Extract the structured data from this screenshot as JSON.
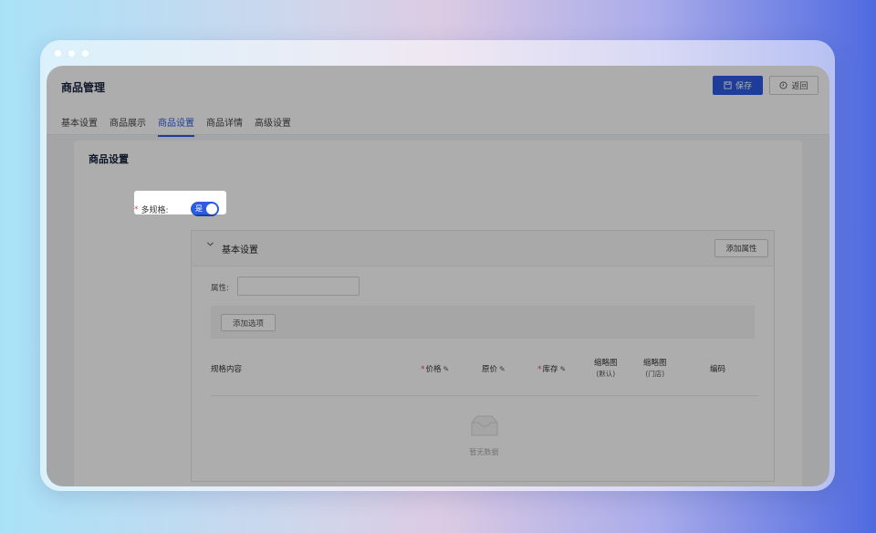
{
  "header": {
    "title": "商品管理",
    "save_label": "保存",
    "back_label": "返回"
  },
  "tabs": [
    {
      "label": "基本设置"
    },
    {
      "label": "商品展示"
    },
    {
      "label": "商品设置",
      "active": true
    },
    {
      "label": "商品详情"
    },
    {
      "label": "高级设置"
    }
  ],
  "section": {
    "title": "商品设置",
    "multi_spec_label": "多规格:",
    "multi_spec_required": "*",
    "toggle_text": "是",
    "toggle_on": true
  },
  "panel": {
    "title": "基本设置",
    "add_attr_label": "添加属性",
    "attr_label": "属性:",
    "attr_value": "",
    "add_option_label": "添加选项"
  },
  "table": {
    "col_spec": "规格内容",
    "col_price": "价格",
    "col_orig_price": "原价",
    "col_stock": "库存",
    "col_thumb_default": "缩略图",
    "col_thumb_default_sub": "(默认)",
    "col_thumb_store": "缩略图",
    "col_thumb_store_sub": "(门店)",
    "col_code": "编码",
    "required_mark": "*",
    "empty_text": "暂无数据"
  },
  "colors": {
    "primary": "#2d5be3",
    "required": "#e34d4d"
  }
}
